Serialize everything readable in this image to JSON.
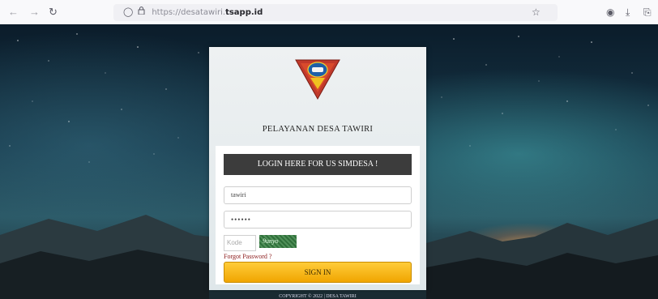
{
  "browser": {
    "url_prefix": "https://desatawiri.",
    "url_domain": "tsapp.id",
    "icons": {
      "back": "arrow-left-icon",
      "forward": "arrow-right-icon",
      "reload": "reload-icon",
      "shield": "shield-icon",
      "lock": "lock-icon",
      "bookmark": "star-icon",
      "pocket": "pocket-icon",
      "downloads": "download-icon",
      "extensions": "extensions-icon"
    }
  },
  "login": {
    "app_title": "PELAYANAN DESA TAWIRI",
    "header": "LOGIN HERE FOR US SIMDESA !",
    "username_value": "tawiri",
    "password_value": "••••••",
    "captcha_placeholder": "Kode",
    "captcha_text": "9unyo",
    "forgot_label": "Forgot Password ?",
    "signin_label": "SIGN IN",
    "copyright": "COPYRIGHT © 2022 | DESA TAWIRI"
  },
  "colors": {
    "header_bg": "#3c3c3c",
    "signin_bg": "#ffbe1a",
    "forgot_text": "#8b1a1a",
    "panel_bg": "#e6ecee"
  }
}
